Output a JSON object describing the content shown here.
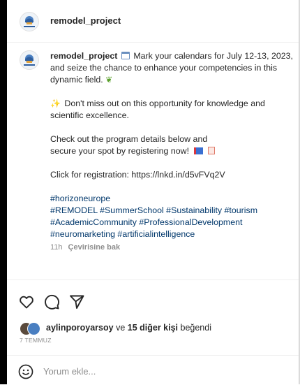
{
  "post": {
    "username": "remodel_project",
    "caption": {
      "line1": "Mark your calendars for July 12-13, 2023,",
      "line2": "and seize the chance to enhance your competencies in this",
      "line3": "dynamic field.",
      "para2_line1": "Don't miss out on this opportunity for knowledge and",
      "para2_line2": "scientific excellence.",
      "para3_line1": "Check out the program details below and",
      "para3_line2": "secure your spot by registering now!",
      "para4": "Click for registration: https://lnkd.in/d5vFVq2V",
      "hashtags_line1": "#horizoneurope",
      "hashtags_line2": "#REMODEL #SummerSchool #Sustainability #tourism",
      "hashtags_line3": "#AcademicCommunity #ProfessionalDevelopment",
      "hashtags_line4": "#neuromarketing #artificialintelligence"
    },
    "time_ago": "11h",
    "translate_label": "Çevirisine bak",
    "liked_by_user": "aylinporoyarsoy",
    "liked_by_connector": "ve",
    "liked_by_others": "15 diğer kişi",
    "liked_by_suffix": "beğendi",
    "date": "7 TEMMUZ"
  },
  "comment": {
    "placeholder": "Yorum ekle..."
  },
  "icons": {
    "like": "heart-icon",
    "comment": "comment-bubble-icon",
    "share": "paper-plane-icon",
    "emoji": "smiley-icon"
  },
  "colors": {
    "text": "#262626",
    "secondary": "#8e8e8e",
    "hashtag": "#00376b"
  }
}
